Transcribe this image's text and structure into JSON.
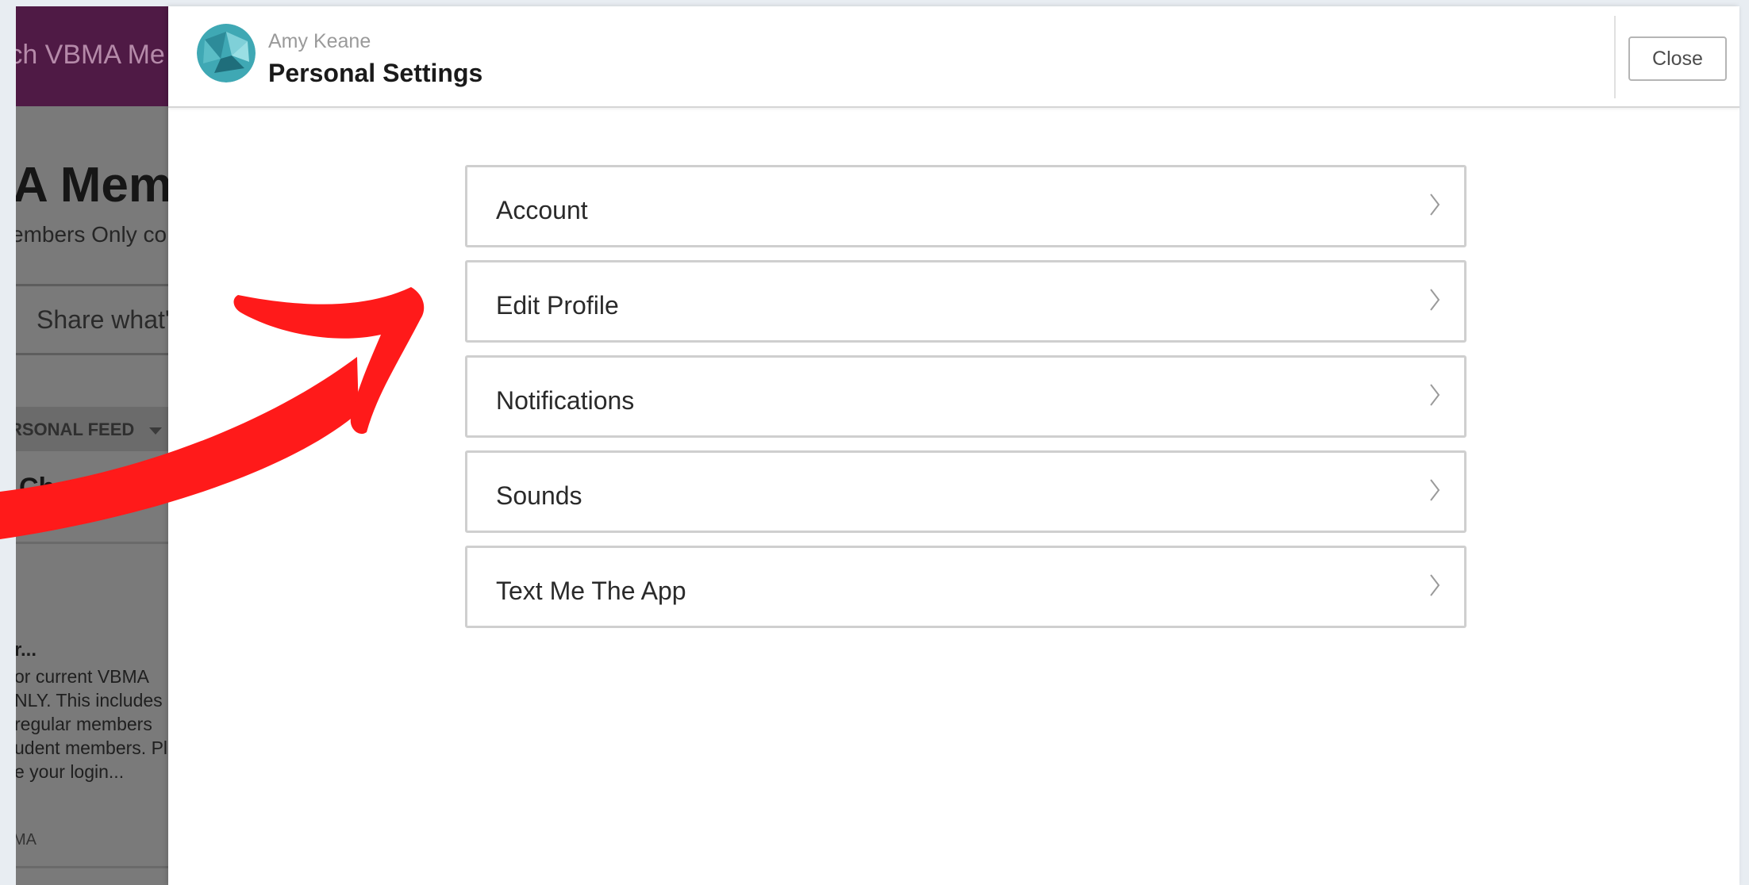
{
  "background": {
    "search_placeholder": "rch VBMA Me",
    "group_title": "A Meml",
    "group_subtitle": "embers Only co",
    "share_placeholder": "Share what'",
    "feed_label": "RSONAL FEED",
    "checklist_title": "Checkli",
    "post": {
      "title": "r...",
      "lines": [
        "or current VBMA",
        "NLY. This includes b",
        "regular members",
        "udent members. Pl",
        "e your login..."
      ],
      "footer": "MA"
    }
  },
  "header": {
    "user_name": "Amy Keane",
    "title": "Personal Settings",
    "close_label": "Close"
  },
  "menu": {
    "items": [
      {
        "label": "Account"
      },
      {
        "label": "Edit Profile"
      },
      {
        "label": "Notifications"
      },
      {
        "label": "Sounds"
      },
      {
        "label": "Text Me The App"
      }
    ]
  },
  "colors": {
    "topbar": "#4f1a45",
    "overlay": "#7a7a7a",
    "arrow": "#ff1a1a",
    "avatar_teal": "#3fa8b4"
  }
}
